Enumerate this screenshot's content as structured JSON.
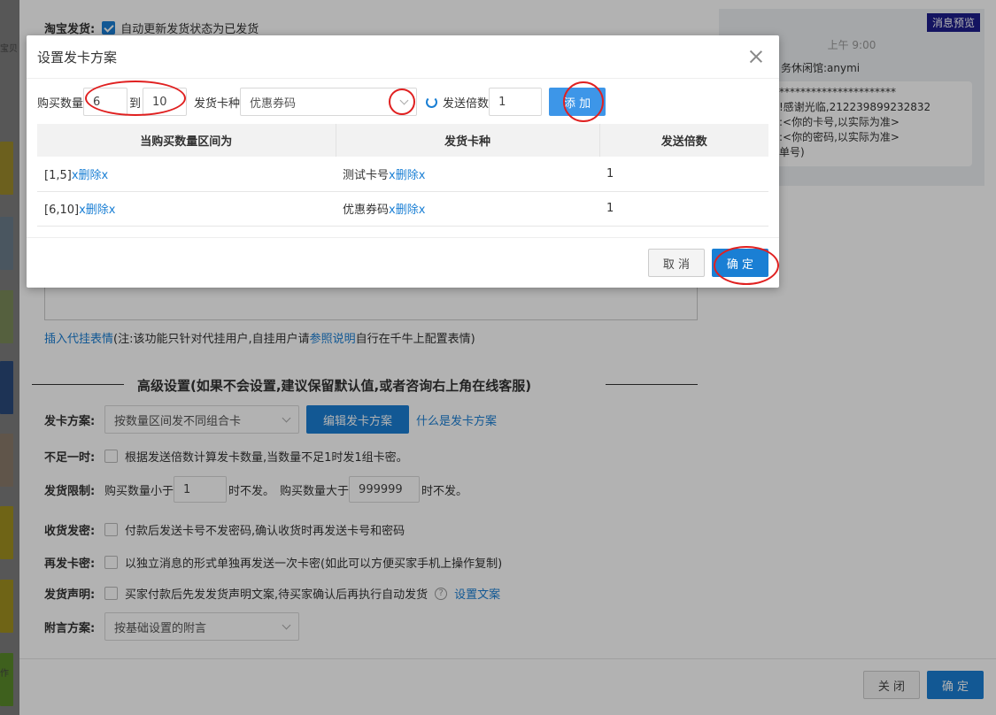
{
  "left_strip": {
    "text1": "宝贝",
    "text2": "作"
  },
  "bg": {
    "taobao_label": "淘宝发货:",
    "taobao_checkbox_text": "自动更新发货状态为已发货",
    "insert_link": "插入代挂表情",
    "note_prefix": "(注:该功能只针对代挂用户,自挂用户请",
    "note_link": "参照说明",
    "note_suffix": "自行在千牛上配置表情)",
    "advanced_title": "高级设置(如果不会设置,建议保留默认值,或者咨询右上角在线客服)",
    "plan_label": "发卡方案:",
    "plan_value": "按数量区间发不同组合卡",
    "edit_plan_button": "编辑发卡方案",
    "what_plan_link": "什么是发卡方案",
    "insufficient_label": "不足一时:",
    "insufficient_text": "根据发送倍数计算发卡数量,当数量不足1时发1组卡密。",
    "limit_label": "发货限制:",
    "limit_less_prefix": "购买数量小于",
    "limit_less_value": "1",
    "limit_less_suffix": "时不发。",
    "limit_more_prefix": "购买数量大于",
    "limit_more_value": "999999",
    "limit_more_suffix": "时不发。",
    "receive_label": "收货发密:",
    "receive_text": "付款后发送卡号不发密码,确认收货时再发送卡号和密码",
    "resend_label": "再发卡密:",
    "resend_text": "以独立消息的形式单独再发送一次卡密(如此可以方便买家手机上操作复制)",
    "statement_label": "发货声明:",
    "statement_text": "买家付款后先发发货声明文案,待买家确认后再执行自动发货",
    "statement_link": "设置文案",
    "note_plan_label": "附言方案:",
    "note_plan_value": "按基础设置的附言",
    "close_button": "关 闭",
    "confirm_button": "确 定"
  },
  "preview": {
    "badge": "消息预览",
    "time": "上午 9:00",
    "name": "务休闲馆:anymi",
    "lines": [
      "**********************",
      "!感谢光临,212239899232832",
      ":<你的卡号,以实际为准>",
      ":<你的密码,以实际为准>",
      "单号)"
    ]
  },
  "modal": {
    "title": "设置发卡方案",
    "qty_label": "购买数量",
    "qty_from": "6",
    "to_label": "到",
    "qty_to": "10",
    "card_type_label": "发货卡种",
    "card_type_value": "优惠券码",
    "multiplier_label": "发送倍数",
    "multiplier_value": "1",
    "add_button": "添 加",
    "columns": [
      "当购买数量区间为",
      "发货卡种",
      "发送倍数"
    ],
    "rows": [
      {
        "range": "[1,5]",
        "range_delete": "x删除x",
        "card": "测试卡号",
        "card_delete": "x删除x",
        "multiplier": "1"
      },
      {
        "range": "[6,10]",
        "range_delete": "x删除x",
        "card": "优惠券码",
        "card_delete": "x删除x",
        "multiplier": "1"
      }
    ],
    "cancel_button": "取 消",
    "ok_button": "确 定"
  },
  "colors": {
    "accent": "#1a7fd4",
    "highlight_ring": "#e02020",
    "overlay": "rgba(0,0,0,0.3)"
  }
}
